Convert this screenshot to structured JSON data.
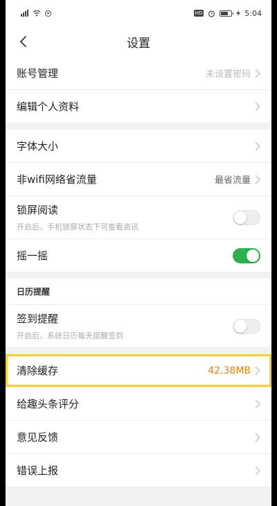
{
  "statusbar": {
    "time": "5:04",
    "hd": "HD",
    "battery_level": 0.6
  },
  "navbar": {
    "title": "设置"
  },
  "account": {
    "account_manage": {
      "label": "账号管理",
      "value": "未设置密码"
    },
    "edit_profile": {
      "label": "编辑个人资料"
    }
  },
  "reading": {
    "font_size": {
      "label": "字体大小"
    },
    "data_saver": {
      "label": "非wifi网络省流量",
      "value": "最省流量"
    },
    "lockscreen": {
      "label": "锁屏阅读",
      "sub": "开启后，手机锁屏状态下可查看资讯",
      "on": false
    },
    "shake": {
      "label": "摇一摇",
      "on": true
    }
  },
  "calendar": {
    "header": "日历提醒",
    "checkin": {
      "label": "签到提醒",
      "sub": "开启后，系统日历每天提醒签到",
      "on": false
    }
  },
  "misc": {
    "clear_cache": {
      "label": "清除缓存",
      "value": "42.38MB"
    },
    "rate_app": {
      "label": "给趣头条评分"
    },
    "feedback": {
      "label": "意见反馈"
    },
    "report_error": {
      "label": "错误上报"
    }
  },
  "colors": {
    "accent_green": "#2bb24c",
    "cache_orange": "#e8820e",
    "highlight_yellow": "#f7d32a"
  }
}
